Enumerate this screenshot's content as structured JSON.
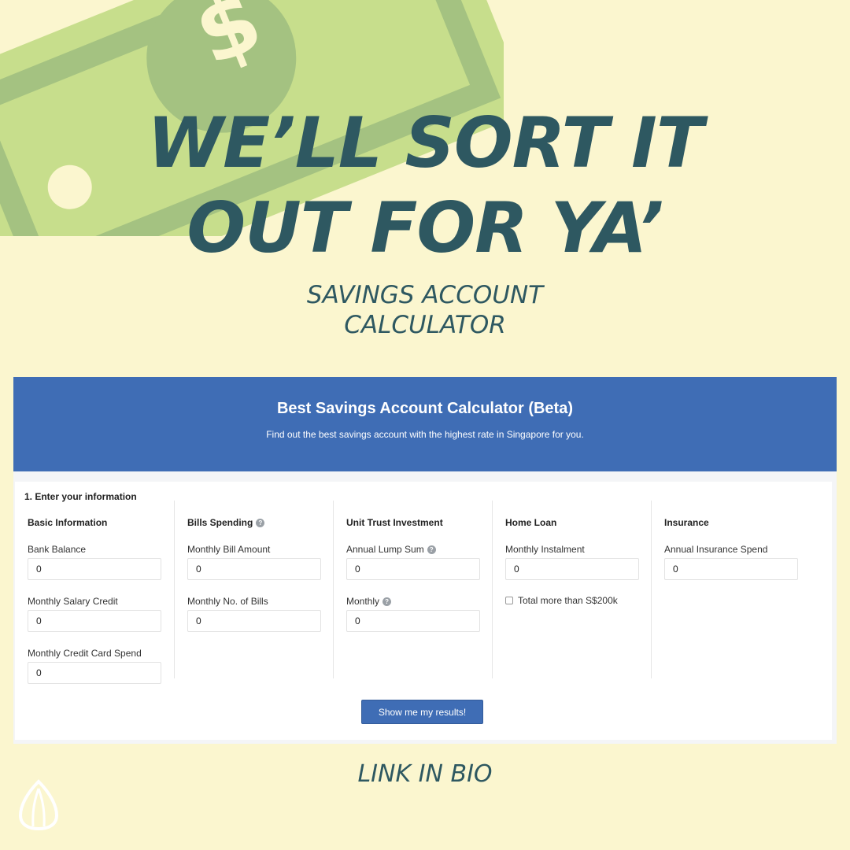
{
  "headline": {
    "line1": "WE’LL SORT IT",
    "line2": "OUT FOR YA’"
  },
  "subheadline": {
    "line1": "SAVINGS ACCOUNT",
    "line2": "CALCULATOR"
  },
  "calculator": {
    "title": "Best Savings Account Calculator (Beta)",
    "subtitle": "Find out the best savings account with the highest rate in Singapore for you.",
    "section_title": "1. Enter your information",
    "columns": {
      "basic": {
        "heading": "Basic Information",
        "bank_balance": {
          "label": "Bank Balance",
          "value": "0"
        },
        "salary_credit": {
          "label": "Monthly Salary Credit",
          "value": "0"
        },
        "credit_card_spend": {
          "label": "Monthly Credit Card Spend",
          "value": "0"
        }
      },
      "bills": {
        "heading": "Bills Spending",
        "bill_amount": {
          "label": "Monthly Bill Amount",
          "value": "0"
        },
        "num_bills": {
          "label": "Monthly No. of Bills",
          "value": "0"
        }
      },
      "unit_trust": {
        "heading": "Unit Trust Investment",
        "lump_sum": {
          "label": "Annual Lump Sum",
          "value": "0"
        },
        "monthly": {
          "label": "Monthly",
          "value": "0"
        }
      },
      "home_loan": {
        "heading": "Home Loan",
        "instalment": {
          "label": "Monthly Instalment",
          "value": "0"
        },
        "checkbox_label": "Total more than S$200k"
      },
      "insurance": {
        "heading": "Insurance",
        "annual_spend": {
          "label": "Annual Insurance Spend",
          "value": "0"
        }
      }
    },
    "help_glyph": "?",
    "submit_label": "Show me my results!"
  },
  "footer": {
    "cta": "LINK IN BIO"
  },
  "colors": {
    "background": "#fbf6cf",
    "headline": "#2e5861",
    "brand_blue": "#3f6db5",
    "bill_light": "#c7de8c",
    "bill_dark": "#9fbd7f"
  },
  "icons": [
    "dollar-bill-illustration",
    "question-circle-icon",
    "seed-logo-icon"
  ]
}
